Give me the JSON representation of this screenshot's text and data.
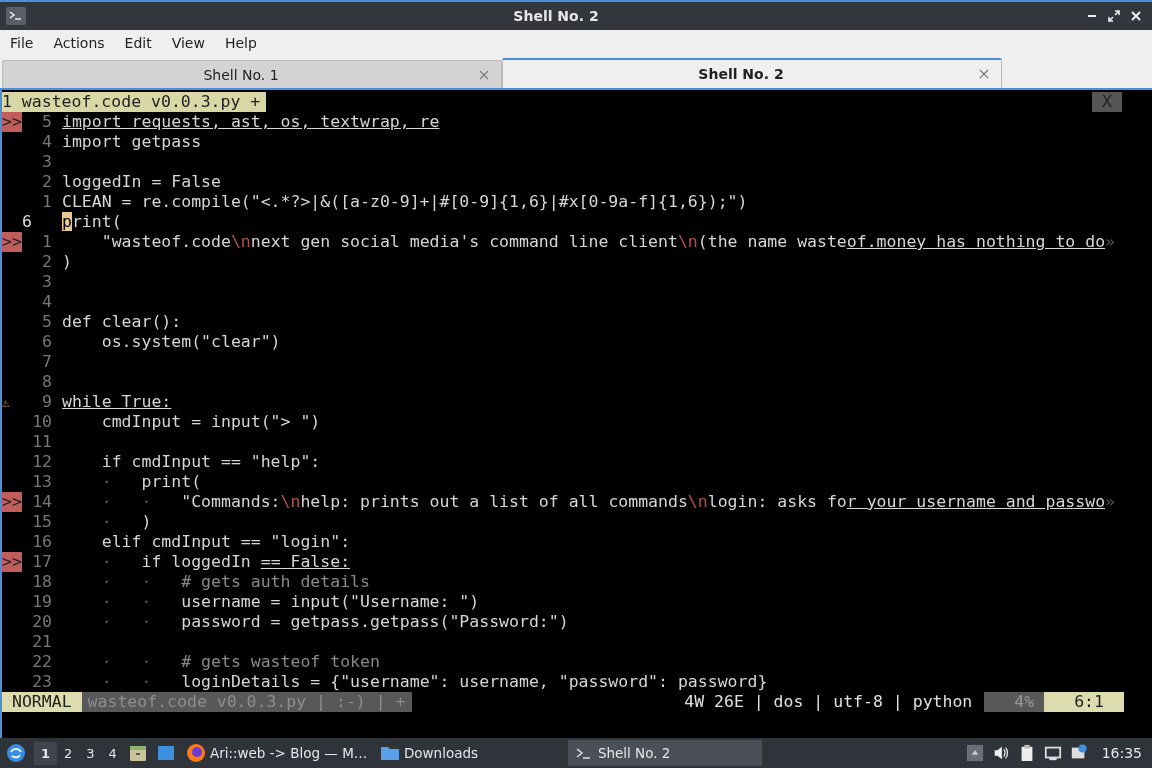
{
  "window": {
    "title": "Shell No. 2"
  },
  "menu": [
    "File",
    "Actions",
    "Edit",
    "View",
    "Help"
  ],
  "tabs": [
    {
      "label": "Shell No. 1",
      "selected": false
    },
    {
      "label": "Shell No. 2",
      "selected": true
    }
  ],
  "editor": {
    "buffer_tab": "1 wasteof.code v0.0.3.py +",
    "close_label": "X",
    "lines": [
      {
        "sign": {
          "kind": "error",
          "text": ">>"
        },
        "number": "5",
        "current": false,
        "segments": [
          {
            "kind": "underline",
            "text": "import requests, ast, os, textwrap, re"
          }
        ]
      },
      {
        "number": "4",
        "current": false,
        "segments": [
          {
            "kind": "code",
            "text": "import getpass"
          }
        ]
      },
      {
        "number": "3",
        "current": false
      },
      {
        "number": "2",
        "current": false,
        "segments": [
          {
            "kind": "code",
            "text": "loggedIn = False"
          }
        ]
      },
      {
        "number": "1",
        "current": false,
        "segments": [
          {
            "kind": "code",
            "text": "CLEAN = re.compile(\"<.*?>|&([a-z0-9]+|#[0-9]{1,6}|#x[0-9a-f]{1,6});\")"
          }
        ]
      },
      {
        "number": "6",
        "current": true,
        "segments": [
          {
            "kind": "cursor",
            "text": "p"
          },
          {
            "kind": "code",
            "text": "rint("
          }
        ]
      },
      {
        "sign": {
          "kind": "error",
          "text": ">>"
        },
        "number": "1",
        "current": false,
        "segments": [
          {
            "kind": "code",
            "text": "    \"wasteof.code"
          },
          {
            "kind": "escape",
            "text": "\\n"
          },
          {
            "kind": "code",
            "text": "next gen social media's command line client"
          },
          {
            "kind": "escape",
            "text": "\\n"
          },
          {
            "kind": "code",
            "text": "(the name waste"
          },
          {
            "kind": "underline",
            "text": "of.money has nothing to do"
          },
          {
            "kind": "guide",
            "text": "»"
          }
        ]
      },
      {
        "number": "2",
        "current": false,
        "segments": [
          {
            "kind": "code",
            "text": ")"
          }
        ]
      },
      {
        "number": "3",
        "current": false
      },
      {
        "number": "4",
        "current": false
      },
      {
        "number": "5",
        "current": false,
        "segments": [
          {
            "kind": "code",
            "text": "def clear():"
          }
        ]
      },
      {
        "number": "6",
        "current": false,
        "segments": [
          {
            "kind": "code",
            "text": "    os.system(\"clear\")"
          }
        ]
      },
      {
        "number": "7",
        "current": false
      },
      {
        "number": "8",
        "current": false
      },
      {
        "sign": {
          "kind": "warning",
          "text": "⚠"
        },
        "number": "9",
        "current": false,
        "segments": [
          {
            "kind": "underline",
            "text": "while True:"
          }
        ]
      },
      {
        "number": "10",
        "current": false,
        "segments": [
          {
            "kind": "code",
            "text": "    cmdInput = input(\"> \")"
          }
        ]
      },
      {
        "number": "11",
        "current": false
      },
      {
        "number": "12",
        "current": false,
        "segments": [
          {
            "kind": "code",
            "text": "    if cmdInput == \"help\":"
          }
        ]
      },
      {
        "number": "13",
        "current": false,
        "segments": [
          {
            "kind": "guide",
            "text": "    ·   "
          },
          {
            "kind": "code",
            "text": "print("
          }
        ]
      },
      {
        "sign": {
          "kind": "error",
          "text": ">>"
        },
        "number": "14",
        "current": false,
        "segments": [
          {
            "kind": "guide",
            "text": "    ·   ·   "
          },
          {
            "kind": "code",
            "text": "\"Commands:"
          },
          {
            "kind": "escape",
            "text": "\\n"
          },
          {
            "kind": "code",
            "text": "help: prints out a list of all commands"
          },
          {
            "kind": "escape",
            "text": "\\n"
          },
          {
            "kind": "code",
            "text": "login: asks fo"
          },
          {
            "kind": "underline",
            "text": "r your username and passwo"
          },
          {
            "kind": "guide",
            "text": "»"
          }
        ]
      },
      {
        "number": "15",
        "current": false,
        "segments": [
          {
            "kind": "guide",
            "text": "    ·   "
          },
          {
            "kind": "code",
            "text": ")"
          }
        ]
      },
      {
        "number": "16",
        "current": false,
        "segments": [
          {
            "kind": "code",
            "text": "    elif cmdInput == \"login\":"
          }
        ]
      },
      {
        "sign": {
          "kind": "error",
          "text": ">>"
        },
        "number": "17",
        "current": false,
        "segments": [
          {
            "kind": "guide",
            "text": "    ·   "
          },
          {
            "kind": "code",
            "text": "if loggedIn "
          },
          {
            "kind": "underline",
            "text": "== False:"
          }
        ]
      },
      {
        "number": "18",
        "current": false,
        "segments": [
          {
            "kind": "guide",
            "text": "    ·   ·   "
          },
          {
            "kind": "comment",
            "text": "# gets auth details"
          }
        ]
      },
      {
        "number": "19",
        "current": false,
        "segments": [
          {
            "kind": "guide",
            "text": "    ·   ·   "
          },
          {
            "kind": "code",
            "text": "username = input(\"Username: \")"
          }
        ]
      },
      {
        "number": "20",
        "current": false,
        "segments": [
          {
            "kind": "guide",
            "text": "    ·   ·   "
          },
          {
            "kind": "code",
            "text": "password = getpass.getpass(\"Password:\")"
          }
        ]
      },
      {
        "number": "21",
        "current": false
      },
      {
        "number": "22",
        "current": false,
        "segments": [
          {
            "kind": "guide",
            "text": "    ·   ·   "
          },
          {
            "kind": "comment",
            "text": "# gets wasteof token"
          }
        ]
      },
      {
        "number": "23",
        "current": false,
        "segments": [
          {
            "kind": "guide",
            "text": "    ·   ·   "
          },
          {
            "kind": "code",
            "text": "loginDetails = {\"username\": username, \"password\": password}"
          }
        ]
      }
    ],
    "statusline": {
      "mode": "NORMAL",
      "file": "wasteof.code v0.0.3.py | :-) | +",
      "info": "4W 26E | dos | utf-8 | python",
      "percent": "4%",
      "position": "6:1"
    }
  },
  "taskbar": {
    "workspaces": [
      {
        "label": "1",
        "selected": true
      },
      {
        "label": "2",
        "selected": false
      },
      {
        "label": "3",
        "selected": false
      },
      {
        "label": "4",
        "selected": false
      }
    ],
    "tasks": [
      {
        "kind": "browser",
        "label": "Ari::web -> Blog — M…",
        "selected": false
      },
      {
        "kind": "folder",
        "label": "Downloads",
        "selected": false
      },
      {
        "kind": "terminal",
        "label": "Shell No. 2",
        "selected": true
      }
    ],
    "clock": "16:35"
  }
}
